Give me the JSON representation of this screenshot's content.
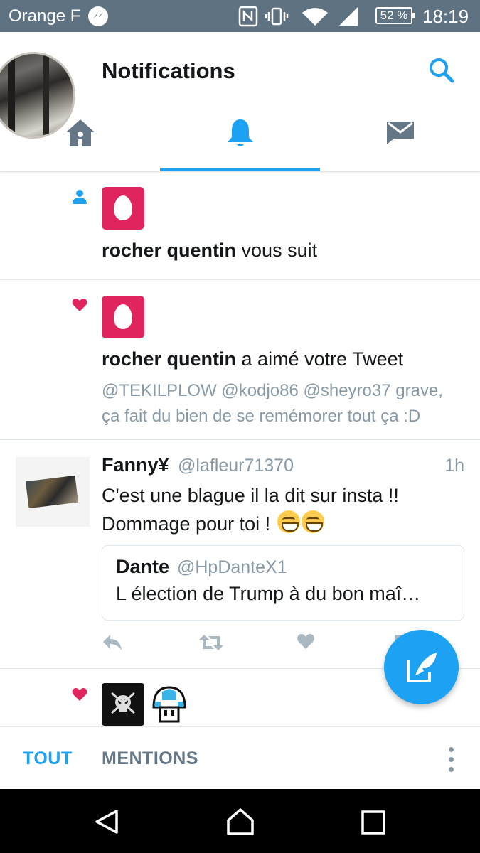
{
  "status_bar": {
    "carrier": "Orange F",
    "battery": "52 %",
    "time": "18:19",
    "icons": [
      "messenger-icon",
      "nfc-icon",
      "vibrate-icon",
      "wifi-icon",
      "signal-icon",
      "battery-icon"
    ]
  },
  "header": {
    "title": "Notifications",
    "tabs": [
      {
        "name": "home",
        "icon": "home-icon",
        "active": false
      },
      {
        "name": "notifications",
        "icon": "bell-icon",
        "active": true
      },
      {
        "name": "messages",
        "icon": "envelope-icon",
        "active": false
      }
    ]
  },
  "notifications": {
    "follow": {
      "name": "rocher quentin",
      "action": "vous suit",
      "icon": "person-icon"
    },
    "like": {
      "name": "rocher quentin",
      "action": "a aimé votre Tweet",
      "icon": "heart-icon",
      "tweet_line1": "@TEKILPLOW  @kodjo86 @sheyro37 grave,",
      "tweet_line2": "ça fait du bien de se remémorer tout ça :D"
    },
    "tweet": {
      "name": "Fanny¥",
      "handle": "@lafleur71370",
      "time": "1h",
      "line1": "C'est une blague il la dit sur insta !!",
      "line2": "Dommage pour toi !",
      "quote": {
        "name": "Dante",
        "handle": "@HpDanteX1",
        "text": "L élection de Trump à du bon maî…"
      }
    },
    "like2": {
      "icon": "heart-icon"
    }
  },
  "bottom_tabs": {
    "all": "TOUT",
    "mentions": "MENTIONS"
  },
  "colors": {
    "accent": "#1da1f2",
    "like": "#e0245e",
    "status_bar": "#5f7282",
    "secondary_text": "#8899a6"
  }
}
